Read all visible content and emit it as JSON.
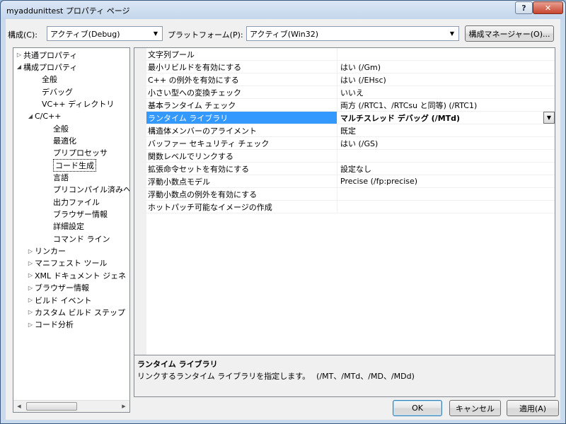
{
  "window": {
    "title": "myaddunittest プロパティ ページ",
    "help_label": "?",
    "close_label": "✕"
  },
  "config_bar": {
    "configuration_label": "構成(C):",
    "configuration_value": "アクティブ(Debug)",
    "platform_label": "プラットフォーム(P):",
    "platform_value": "アクティブ(Win32)",
    "manager_button": "構成マネージャー(O)..."
  },
  "tree": {
    "items": [
      {
        "label": "共通プロパティ",
        "expander": "▷"
      },
      {
        "label": "構成プロパティ",
        "expander": "◢"
      },
      {
        "label": "全般",
        "expander": ""
      },
      {
        "label": "デバッグ",
        "expander": ""
      },
      {
        "label": "VC++ ディレクトリ",
        "expander": ""
      },
      {
        "label": "C/C++",
        "expander": "◢"
      },
      {
        "label": "全般",
        "expander": ""
      },
      {
        "label": "最適化",
        "expander": ""
      },
      {
        "label": "プリプロセッサ",
        "expander": ""
      },
      {
        "label": "コード生成",
        "expander": ""
      },
      {
        "label": "言語",
        "expander": ""
      },
      {
        "label": "プリコンパイル済みヘ",
        "expander": ""
      },
      {
        "label": "出力ファイル",
        "expander": ""
      },
      {
        "label": "ブラウザー情報",
        "expander": ""
      },
      {
        "label": "詳細設定",
        "expander": ""
      },
      {
        "label": "コマンド ライン",
        "expander": ""
      },
      {
        "label": "リンカー",
        "expander": "▷"
      },
      {
        "label": "マニフェスト ツール",
        "expander": "▷"
      },
      {
        "label": "XML ドキュメント ジェネ",
        "expander": "▷"
      },
      {
        "label": "ブラウザー情報",
        "expander": "▷"
      },
      {
        "label": "ビルド イベント",
        "expander": "▷"
      },
      {
        "label": "カスタム ビルド ステップ",
        "expander": "▷"
      },
      {
        "label": "コード分析",
        "expander": "▷"
      }
    ],
    "scroll_left": "◀",
    "scroll_right": "▶"
  },
  "properties": {
    "rows": [
      {
        "name": "文字列プール",
        "value": ""
      },
      {
        "name": "最小リビルドを有効にする",
        "value": "はい (/Gm)"
      },
      {
        "name": "C++ の例外を有効にする",
        "value": "はい (/EHsc)"
      },
      {
        "name": "小さい型への変換チェック",
        "value": "いいえ"
      },
      {
        "name": "基本ランタイム チェック",
        "value": "両方 (/RTC1、/RTCsu と同等) (/RTC1)"
      },
      {
        "name": "ランタイム ライブラリ",
        "value": "マルチスレッド デバッグ (/MTd)"
      },
      {
        "name": "構造体メンバーのアライメント",
        "value": "既定"
      },
      {
        "name": "バッファー セキュリティ チェック",
        "value": "はい (/GS)"
      },
      {
        "name": "関数レベルでリンクする",
        "value": ""
      },
      {
        "name": "拡張命令セットを有効にする",
        "value": "設定なし"
      },
      {
        "name": "浮動小数点モデル",
        "value": "Precise (/fp:precise)"
      },
      {
        "name": "浮動小数点の例外を有効にする",
        "value": ""
      },
      {
        "name": "ホットパッチ可能なイメージの作成",
        "value": ""
      }
    ],
    "dropdown_arrow": "▼"
  },
  "description": {
    "title": "ランタイム ライブラリ",
    "text": "リンクするランタイム ライブラリを指定します。　 (/MT、/MTd、/MD、/MDd)"
  },
  "buttons": {
    "ok": "OK",
    "cancel": "キャンセル",
    "apply": "適用(A)"
  }
}
